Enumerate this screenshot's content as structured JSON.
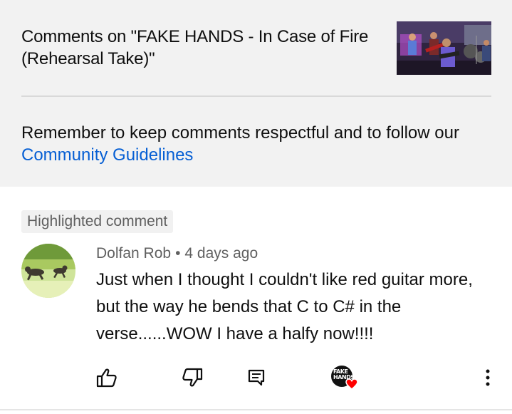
{
  "header": {
    "title": "Comments on \"FAKE HANDS - In Case of Fire (Rehearsal Take)\"",
    "thumbnail_icon": "band-rehearsal-thumbnail"
  },
  "reminder": {
    "text": "Remember to keep comments respectful and to follow our ",
    "link": "Community Guidelines"
  },
  "comment": {
    "badge": "Highlighted comment",
    "author": "Dolfan Rob",
    "separator": "•",
    "time": "4 days ago",
    "text": "Just when I thought I couldn't like red guitar more, but the way he bends that C to C# in the verse......WOW I have a halfy now!!!!",
    "avatar_icon": "dogs-running-avatar"
  },
  "actions": {
    "like_icon": "thumbs-up-icon",
    "dislike_icon": "thumbs-down-icon",
    "reply_icon": "reply-icon",
    "creator_heart_logo": "FAKE HANDS",
    "heart_color": "#ff0000",
    "more_icon": "more-vertical-icon"
  },
  "colors": {
    "link": "#065fd4",
    "secondary_text": "#606060",
    "header_bg": "#f2f2f2"
  }
}
